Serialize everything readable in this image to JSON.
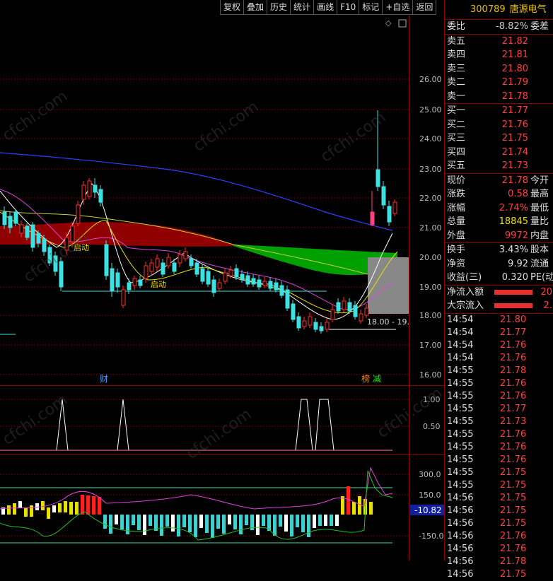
{
  "toolbar": [
    "复权",
    "叠加",
    "历史",
    "统计",
    "画线",
    "F10",
    "标记",
    "+自选",
    "返回"
  ],
  "stock": {
    "code": "300789",
    "name": "唐源电气"
  },
  "wei": {
    "label": "委比",
    "value": "-8.82%",
    "label2": "委差"
  },
  "asks": [
    {
      "label": "卖五",
      "price": "21.82"
    },
    {
      "label": "卖四",
      "price": "21.81"
    },
    {
      "label": "卖三",
      "price": "21.80"
    },
    {
      "label": "卖二",
      "price": "21.79"
    },
    {
      "label": "卖一",
      "price": "21.78"
    }
  ],
  "bids": [
    {
      "label": "买一",
      "price": "21.77"
    },
    {
      "label": "买二",
      "price": "21.76"
    },
    {
      "label": "买三",
      "price": "21.75"
    },
    {
      "label": "买四",
      "price": "21.74"
    },
    {
      "label": "买五",
      "price": "21.73"
    }
  ],
  "quote": [
    {
      "label": "现价",
      "value": "21.78",
      "color": "red",
      "label2": "今开"
    },
    {
      "label": "涨跌",
      "value": "0.58",
      "color": "red",
      "label2": "最高"
    },
    {
      "label": "涨幅",
      "value": "2.74%",
      "color": "red",
      "label2": "最低"
    },
    {
      "label": "总量",
      "value": "18845",
      "color": "yellow",
      "label2": "量比"
    },
    {
      "label": "外盘",
      "value": "9972",
      "color": "red",
      "label2": "内盘"
    }
  ],
  "fund": [
    {
      "label": "换手",
      "value": "3.43%",
      "label2": "股本"
    },
    {
      "label": "净资",
      "value": "9.92",
      "label2": "流通"
    },
    {
      "label": "收益(三)",
      "value": "0.320",
      "label2": "PE(动"
    }
  ],
  "flows": [
    {
      "label": "净流入额",
      "value": "20"
    },
    {
      "label": "大宗流入",
      "value": "2."
    }
  ],
  "ticks": [
    {
      "time": "14:54",
      "price": "21.80"
    },
    {
      "time": "14:54",
      "price": "21.77"
    },
    {
      "time": "14:54",
      "price": "21.76"
    },
    {
      "time": "14:54",
      "price": "21.76"
    },
    {
      "time": "14:55",
      "price": "21.78"
    },
    {
      "time": "14:55",
      "price": "21.76"
    },
    {
      "time": "14:55",
      "price": "21.76"
    },
    {
      "time": "14:55",
      "price": "21.77"
    },
    {
      "time": "14:55",
      "price": "21.73"
    },
    {
      "time": "14:55",
      "price": "21.76"
    },
    {
      "time": "14:55",
      "price": "21.76"
    },
    {
      "time": "14:55",
      "price": "21.76"
    },
    {
      "time": "14:55",
      "price": "21.75"
    },
    {
      "time": "14:55",
      "price": "21.75"
    },
    {
      "time": "14:56",
      "price": "21.75"
    },
    {
      "time": "14:56",
      "price": "21.75"
    },
    {
      "time": "14:56",
      "price": "21.75"
    },
    {
      "time": "14:56",
      "price": "21.76"
    },
    {
      "time": "14:56",
      "price": "21.76"
    },
    {
      "time": "14:56",
      "price": "21.78"
    },
    {
      "time": "14:56",
      "price": "21.75"
    }
  ],
  "main_axis": [
    "26.00",
    "25.00",
    "24.00",
    "23.00",
    "22.00",
    "21.00",
    "20.00",
    "19.00",
    "18.00",
    "17.00",
    "16.00"
  ],
  "sub1_axis": [
    "1.00",
    "0.50"
  ],
  "sub2_axis": [
    "300.0",
    "150.0",
    "-150.0"
  ],
  "sub2_current": "-10.82",
  "annotations": {
    "qidong1": "启动",
    "qidong2": "启动",
    "range": "18.00 - 19.",
    "cai": "财",
    "bang": "榜",
    "jian": "减",
    "watermark": "cfchi.com"
  },
  "colors": {
    "up": "#ff3030",
    "down": "#40e0e0",
    "ma_blue": "#3040ff",
    "ma_white": "#ffffff",
    "ma_yellow": "#e8e000",
    "ma_magenta": "#e040e0"
  }
}
